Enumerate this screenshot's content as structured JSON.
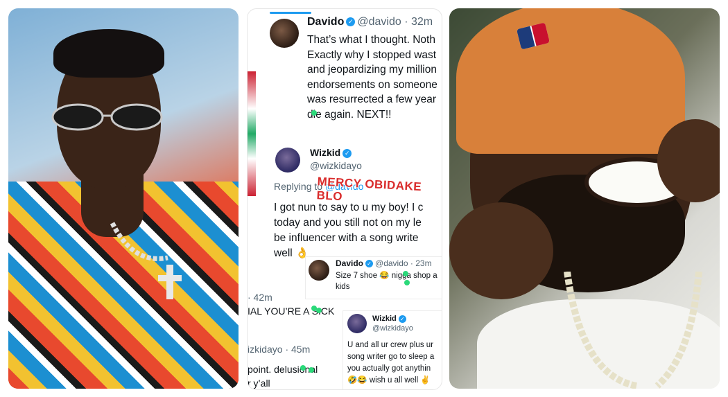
{
  "tweets": {
    "t1": {
      "name": "Davido",
      "handle": "@davido",
      "time": "· 32m",
      "lines": [
        "That’s what I thought. Noth",
        "Exactly why I stopped wast",
        "and jeopardizing my million",
        "endorsements on someone",
        "was resurrected a few year",
        "die again. NEXT!!"
      ]
    },
    "t2": {
      "name": "Wizkid",
      "handle": "@wizkidayo",
      "replying_prefix": "Replying to",
      "replying_handle": "@davido",
      "lines": [
        "I got nun to say to u my boy! I c",
        "today and you still not on my le",
        "be influencer with a song write",
        "well 👌"
      ]
    },
    "t3": {
      "name": "Davido",
      "handle": "@davido",
      "time": "· 23m",
      "lines": [
        "Size 7 shoe 😂 nigga shop a",
        "kids"
      ]
    },
    "t4": {
      "name": "Wizkid",
      "handle": "@wizkidayo",
      "lines": [
        "U and all ur crew plus ur",
        "song writer go to sleep a",
        "you actually got anythin",
        "🤣😂 wish u all well ✌"
      ]
    },
    "fragments": {
      "time_a": "· 42m",
      "text_a": "IAL YOU’RE A SICK",
      "handle_b": "izkidayo · 45m",
      "text_b1": "point. delusional",
      "text_b2": "r y’all"
    },
    "watermark": "MERCY OBIDAKE BLO"
  },
  "colors": {
    "verified": "#1d9bf0",
    "watermark": "#d92c2c",
    "dots": "#2bd97a"
  },
  "icons": [
    "verified-icon",
    "avatar"
  ]
}
